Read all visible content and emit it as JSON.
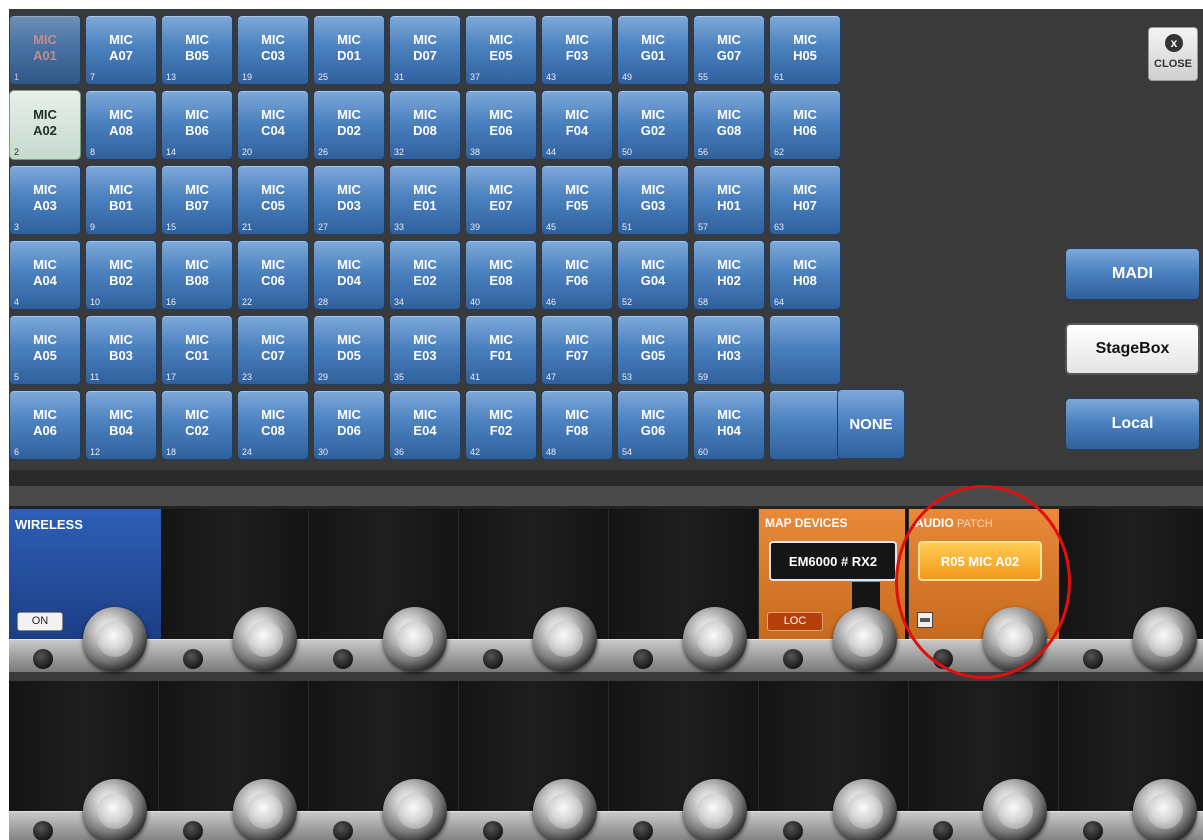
{
  "grid": {
    "columns": [
      [
        {
          "l1": "MIC",
          "l2": "A01",
          "num": "1",
          "state": "dim"
        },
        {
          "l1": "MIC",
          "l2": "A02",
          "num": "2",
          "state": "sel"
        },
        {
          "l1": "MIC",
          "l2": "A03",
          "num": "3"
        },
        {
          "l1": "MIC",
          "l2": "A04",
          "num": "4"
        },
        {
          "l1": "MIC",
          "l2": "A05",
          "num": "5"
        },
        {
          "l1": "MIC",
          "l2": "A06",
          "num": "6"
        }
      ],
      [
        {
          "l1": "MIC",
          "l2": "A07",
          "num": "7"
        },
        {
          "l1": "MIC",
          "l2": "A08",
          "num": "8"
        },
        {
          "l1": "MIC",
          "l2": "B01",
          "num": "9"
        },
        {
          "l1": "MIC",
          "l2": "B02",
          "num": "10"
        },
        {
          "l1": "MIC",
          "l2": "B03",
          "num": "11"
        },
        {
          "l1": "MIC",
          "l2": "B04",
          "num": "12"
        }
      ],
      [
        {
          "l1": "MIC",
          "l2": "B05",
          "num": "13"
        },
        {
          "l1": "MIC",
          "l2": "B06",
          "num": "14"
        },
        {
          "l1": "MIC",
          "l2": "B07",
          "num": "15"
        },
        {
          "l1": "MIC",
          "l2": "B08",
          "num": "16"
        },
        {
          "l1": "MIC",
          "l2": "C01",
          "num": "17"
        },
        {
          "l1": "MIC",
          "l2": "C02",
          "num": "18"
        }
      ],
      [
        {
          "l1": "MIC",
          "l2": "C03",
          "num": "19"
        },
        {
          "l1": "MIC",
          "l2": "C04",
          "num": "20"
        },
        {
          "l1": "MIC",
          "l2": "C05",
          "num": "21"
        },
        {
          "l1": "MIC",
          "l2": "C06",
          "num": "22"
        },
        {
          "l1": "MIC",
          "l2": "C07",
          "num": "23"
        },
        {
          "l1": "MIC",
          "l2": "C08",
          "num": "24"
        }
      ],
      [
        {
          "l1": "MIC",
          "l2": "D01",
          "num": "25"
        },
        {
          "l1": "MIC",
          "l2": "D02",
          "num": "26"
        },
        {
          "l1": "MIC",
          "l2": "D03",
          "num": "27"
        },
        {
          "l1": "MIC",
          "l2": "D04",
          "num": "28"
        },
        {
          "l1": "MIC",
          "l2": "D05",
          "num": "29"
        },
        {
          "l1": "MIC",
          "l2": "D06",
          "num": "30"
        }
      ],
      [
        {
          "l1": "MIC",
          "l2": "D07",
          "num": "31"
        },
        {
          "l1": "MIC",
          "l2": "D08",
          "num": "32"
        },
        {
          "l1": "MIC",
          "l2": "E01",
          "num": "33"
        },
        {
          "l1": "MIC",
          "l2": "E02",
          "num": "34"
        },
        {
          "l1": "MIC",
          "l2": "E03",
          "num": "35"
        },
        {
          "l1": "MIC",
          "l2": "E04",
          "num": "36"
        }
      ],
      [
        {
          "l1": "MIC",
          "l2": "E05",
          "num": "37"
        },
        {
          "l1": "MIC",
          "l2": "E06",
          "num": "38"
        },
        {
          "l1": "MIC",
          "l2": "E07",
          "num": "39"
        },
        {
          "l1": "MIC",
          "l2": "E08",
          "num": "40"
        },
        {
          "l1": "MIC",
          "l2": "F01",
          "num": "41"
        },
        {
          "l1": "MIC",
          "l2": "F02",
          "num": "42"
        }
      ],
      [
        {
          "l1": "MIC",
          "l2": "F03",
          "num": "43"
        },
        {
          "l1": "MIC",
          "l2": "F04",
          "num": "44"
        },
        {
          "l1": "MIC",
          "l2": "F05",
          "num": "45"
        },
        {
          "l1": "MIC",
          "l2": "F06",
          "num": "46"
        },
        {
          "l1": "MIC",
          "l2": "F07",
          "num": "47"
        },
        {
          "l1": "MIC",
          "l2": "F08",
          "num": "48"
        }
      ],
      [
        {
          "l1": "MIC",
          "l2": "G01",
          "num": "49"
        },
        {
          "l1": "MIC",
          "l2": "G02",
          "num": "50"
        },
        {
          "l1": "MIC",
          "l2": "G03",
          "num": "51"
        },
        {
          "l1": "MIC",
          "l2": "G04",
          "num": "52"
        },
        {
          "l1": "MIC",
          "l2": "G05",
          "num": "53"
        },
        {
          "l1": "MIC",
          "l2": "G06",
          "num": "54"
        }
      ],
      [
        {
          "l1": "MIC",
          "l2": "G07",
          "num": "55"
        },
        {
          "l1": "MIC",
          "l2": "G08",
          "num": "56"
        },
        {
          "l1": "MIC",
          "l2": "H01",
          "num": "57"
        },
        {
          "l1": "MIC",
          "l2": "H02",
          "num": "58"
        },
        {
          "l1": "MIC",
          "l2": "H03",
          "num": "59"
        },
        {
          "l1": "MIC",
          "l2": "H04",
          "num": "60"
        }
      ],
      [
        {
          "l1": "MIC",
          "l2": "H05",
          "num": "61"
        },
        {
          "l1": "MIC",
          "l2": "H06",
          "num": "62"
        },
        {
          "l1": "MIC",
          "l2": "H07",
          "num": "63"
        },
        {
          "l1": "MIC",
          "l2": "H08",
          "num": "64"
        },
        {
          "l1": "",
          "l2": "",
          "num": ""
        },
        {
          "l1": "",
          "l2": "",
          "num": ""
        }
      ]
    ],
    "none_label": "NONE"
  },
  "close": {
    "icon_glyph": "x",
    "label": "CLOSE"
  },
  "sources": {
    "madi": "MADI",
    "stagebox": "StageBox",
    "local": "Local",
    "selected": "StageBox"
  },
  "wireless": {
    "label": "WIRELESS",
    "on_label": "ON"
  },
  "map_devices": {
    "label": "MAP DEVICES",
    "device": "EM6000 # RX2",
    "loc_label": "LOC"
  },
  "audio_patch": {
    "label_main": "AUDIO",
    "label_sub": "PATCH",
    "value": "R05 MIC A02"
  },
  "colors": {
    "accent_blue": "#4c82c0",
    "accent_orange": "#e88a3a",
    "highlight_ring": "#e01010"
  },
  "icons": {
    "close": "close-icon",
    "minus": "minus-icon",
    "knob": "rotary-knob-icon"
  }
}
